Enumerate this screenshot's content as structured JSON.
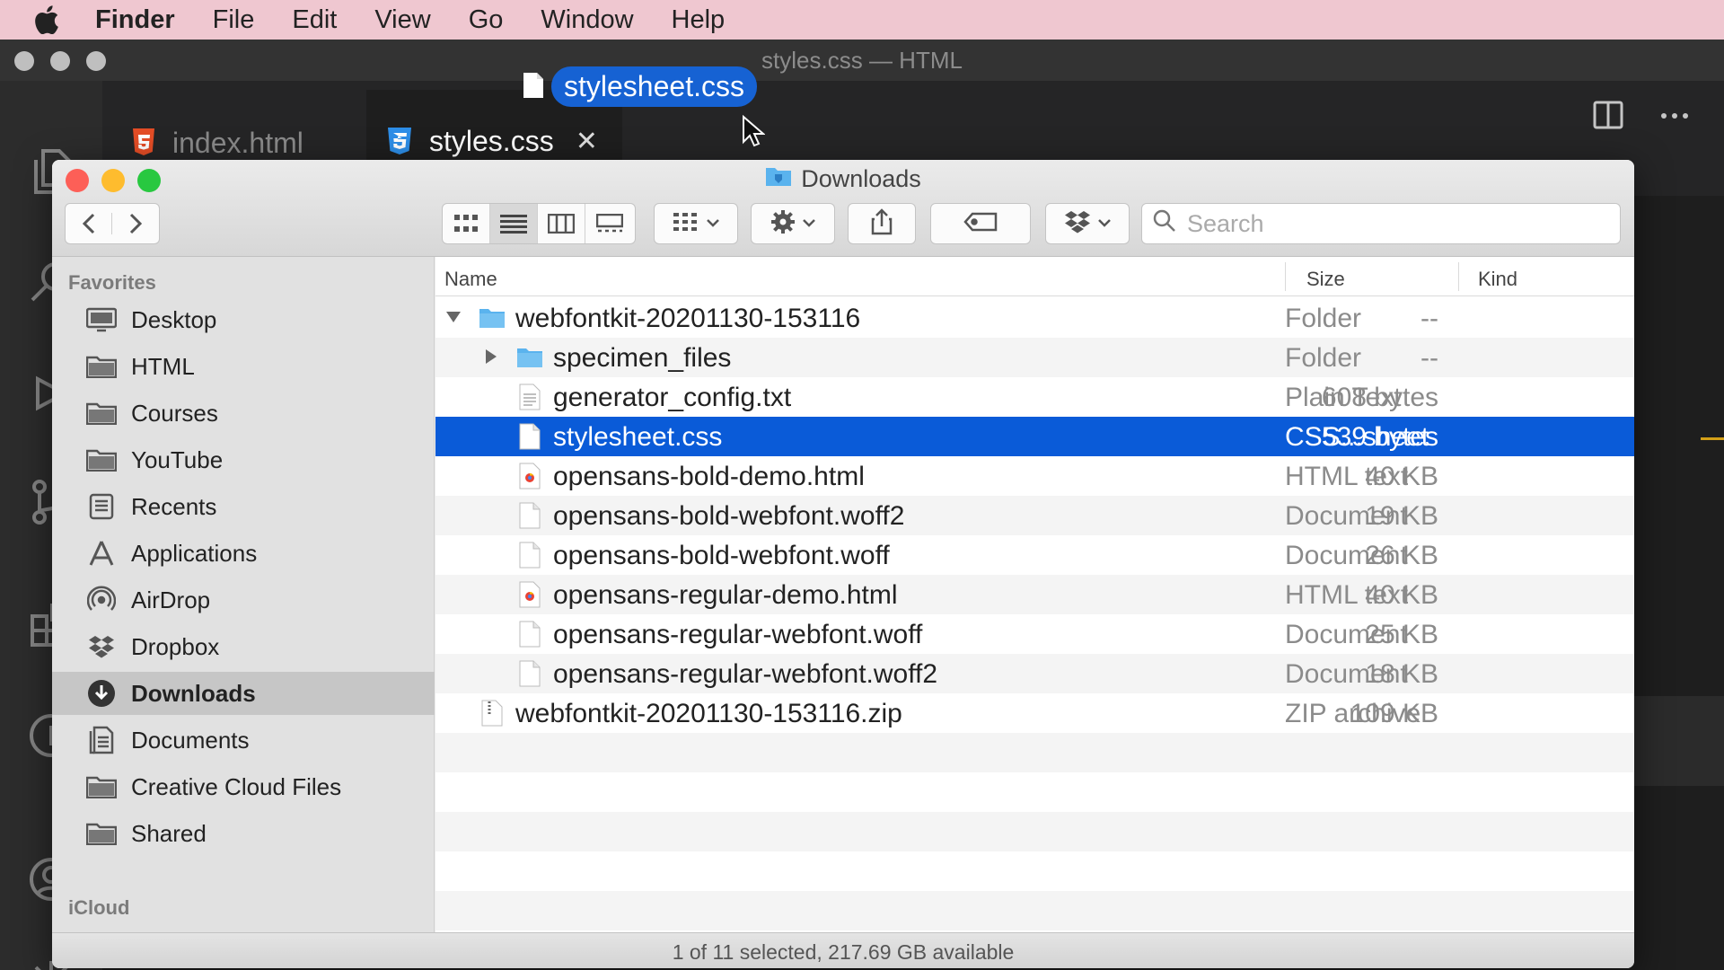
{
  "menubar": {
    "app_name": "Finder",
    "items": [
      "File",
      "Edit",
      "View",
      "Go",
      "Window",
      "Help"
    ]
  },
  "vscode": {
    "window_title": "styles.css — HTML",
    "tabs": [
      {
        "label": "index.html",
        "icon": "html5-icon",
        "active": false
      },
      {
        "label": "styles.css",
        "icon": "css3-icon",
        "active": true
      }
    ],
    "dragged_file": "stylesheet.css"
  },
  "finder": {
    "title": "Downloads",
    "search_placeholder": "Search",
    "sidebar": {
      "favorites_heading": "Favorites",
      "items": [
        {
          "label": "Desktop",
          "icon": "desktop-icon"
        },
        {
          "label": "HTML",
          "icon": "folder-icon"
        },
        {
          "label": "Courses",
          "icon": "folder-icon"
        },
        {
          "label": "YouTube",
          "icon": "folder-icon"
        },
        {
          "label": "Recents",
          "icon": "recents-icon"
        },
        {
          "label": "Applications",
          "icon": "applications-icon"
        },
        {
          "label": "AirDrop",
          "icon": "airdrop-icon"
        },
        {
          "label": "Dropbox",
          "icon": "dropbox-icon"
        },
        {
          "label": "Downloads",
          "icon": "downloads-icon",
          "selected": true
        },
        {
          "label": "Documents",
          "icon": "documents-icon"
        },
        {
          "label": "Creative Cloud Files",
          "icon": "folder-icon"
        },
        {
          "label": "Shared",
          "icon": "folder-icon"
        }
      ],
      "icloud_heading": "iCloud"
    },
    "columns": {
      "name": "Name",
      "size": "Size",
      "kind": "Kind"
    },
    "rows": [
      {
        "name": "webfontkit-20201130-153116",
        "size": "--",
        "kind": "Folder",
        "icon": "folder",
        "indent": 0,
        "disclosure": "expanded"
      },
      {
        "name": "specimen_files",
        "size": "--",
        "kind": "Folder",
        "icon": "folder",
        "indent": 1,
        "disclosure": "collapsed"
      },
      {
        "name": "generator_config.txt",
        "size": "608 bytes",
        "kind": "Plain Text",
        "icon": "text",
        "indent": 1
      },
      {
        "name": "stylesheet.css",
        "size": "539 bytes",
        "kind": "CSS...sheet",
        "icon": "doc",
        "indent": 1,
        "selected": true
      },
      {
        "name": "opensans-bold-demo.html",
        "size": "40 KB",
        "kind": "HTML text",
        "icon": "html",
        "indent": 1
      },
      {
        "name": "opensans-bold-webfont.woff2",
        "size": "19 KB",
        "kind": "Document",
        "icon": "doc",
        "indent": 1
      },
      {
        "name": "opensans-bold-webfont.woff",
        "size": "26 KB",
        "kind": "Document",
        "icon": "doc",
        "indent": 1
      },
      {
        "name": "opensans-regular-demo.html",
        "size": "40 KB",
        "kind": "HTML text",
        "icon": "html",
        "indent": 1
      },
      {
        "name": "opensans-regular-webfont.woff",
        "size": "25 KB",
        "kind": "Document",
        "icon": "doc",
        "indent": 1
      },
      {
        "name": "opensans-regular-webfont.woff2",
        "size": "18 KB",
        "kind": "Document",
        "icon": "doc",
        "indent": 1
      },
      {
        "name": "webfontkit-20201130-153116.zip",
        "size": "109 KB",
        "kind": "ZIP archive",
        "icon": "zip",
        "indent": 0
      }
    ],
    "status": "1 of 11 selected, 217.69 GB available"
  },
  "colors": {
    "menubar_bg": "#efc7d0",
    "selection_blue": "#0a5bd8",
    "drag_label_blue": "#1662d3",
    "folder_blue": "#5ab3ee",
    "close_red": "#fd5f57",
    "minimize_yellow": "#febc2e",
    "zoom_green": "#28c840"
  }
}
